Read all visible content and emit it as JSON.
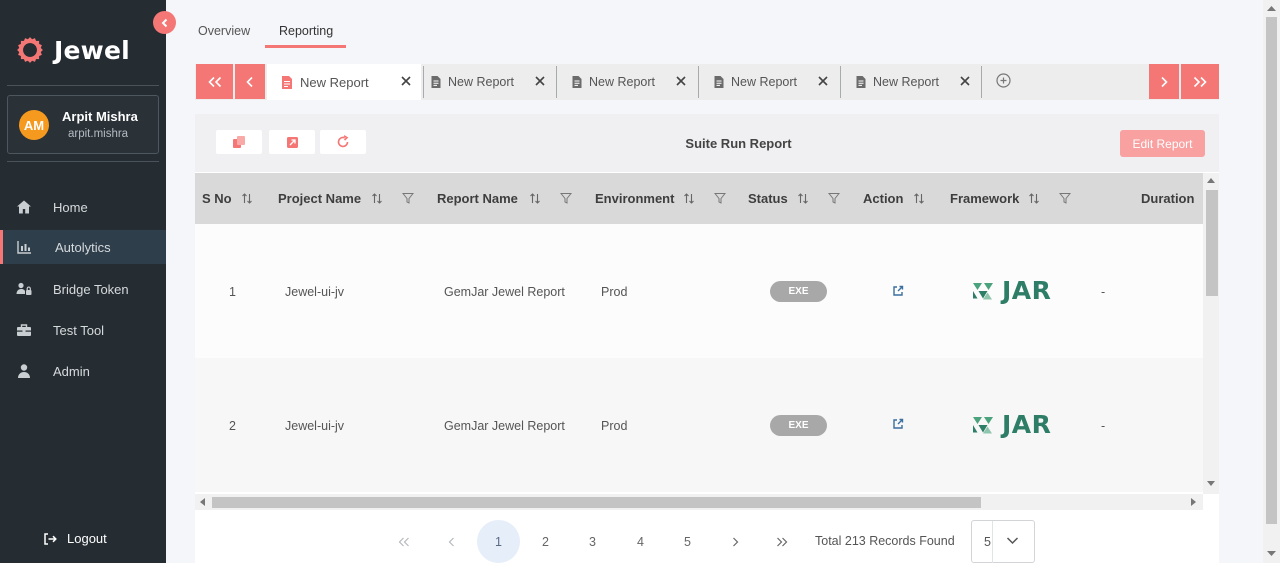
{
  "app": {
    "brand": "Jewel"
  },
  "user": {
    "initials": "AM",
    "name": "Arpit Mishra",
    "handle": "arpit.mishra"
  },
  "sidebar": {
    "items": [
      {
        "label": "Home",
        "icon": "home-icon"
      },
      {
        "label": "Autolytics",
        "icon": "bar-chart-icon",
        "active": true
      },
      {
        "label": "Bridge Token",
        "icon": "users-lock-icon"
      },
      {
        "label": "Test Tool",
        "icon": "toolbox-icon"
      },
      {
        "label": "Admin",
        "icon": "user-icon"
      }
    ],
    "logout": "Logout"
  },
  "tabs": {
    "overview": "Overview",
    "reporting": "Reporting",
    "active": "Reporting"
  },
  "report_tabs": [
    {
      "label": "New Report",
      "active": true
    },
    {
      "label": "New Report"
    },
    {
      "label": "New Report"
    },
    {
      "label": "New Report"
    },
    {
      "label": "New Report"
    }
  ],
  "toolbar": {
    "title": "Suite Run Report",
    "edit_label": "Edit Report"
  },
  "table": {
    "columns": [
      "S No",
      "Project Name",
      "Report Name",
      "Environment",
      "Status",
      "Action",
      "Framework",
      "Duration"
    ],
    "rows": [
      {
        "sno": "1",
        "project": "Jewel-ui-jv",
        "report": "GemJar Jewel Report",
        "env": "Prod",
        "status": "EXE",
        "framework": "JAR",
        "duration": "-"
      },
      {
        "sno": "2",
        "project": "Jewel-ui-jv",
        "report": "GemJar Jewel Report",
        "env": "Prod",
        "status": "EXE",
        "framework": "JAR",
        "duration": "-"
      }
    ]
  },
  "pagination": {
    "pages": [
      "1",
      "2",
      "3",
      "4",
      "5"
    ],
    "current": "1",
    "records_text": "Total 213 Records Found",
    "page_size": "5"
  },
  "colors": {
    "accent": "#f47775",
    "sidebar_bg": "#252d33",
    "jar_green": "#2e7d67"
  }
}
